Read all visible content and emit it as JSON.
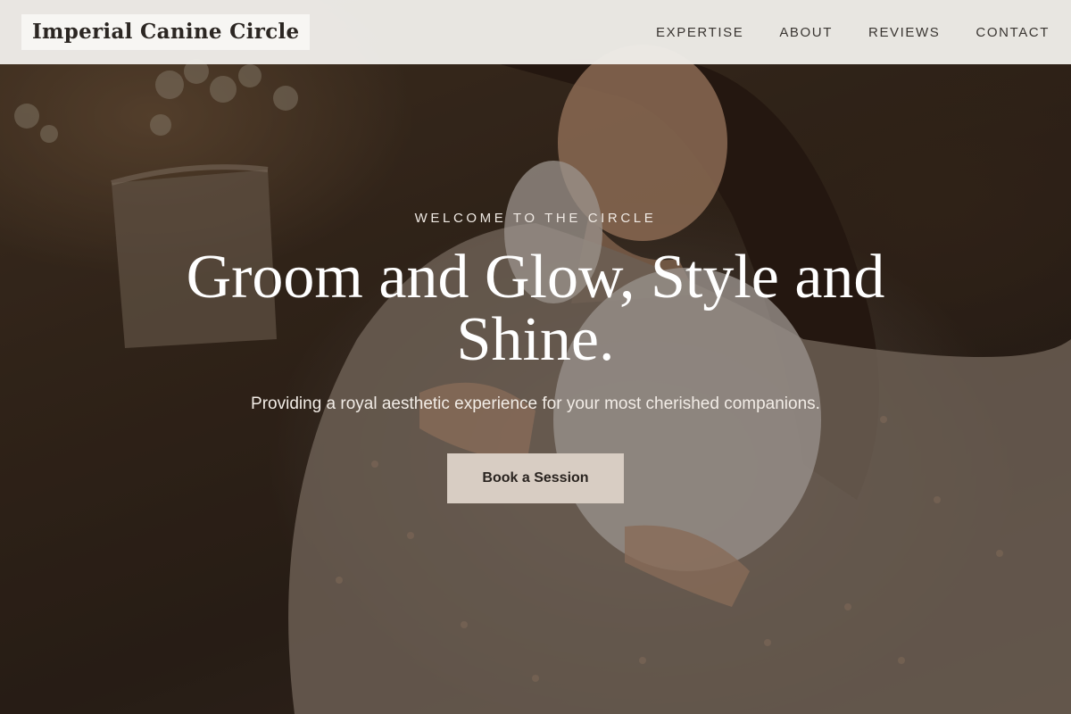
{
  "brand": {
    "name": "Imperial Canine Circle"
  },
  "nav": {
    "items": [
      {
        "label": "EXPERTISE"
      },
      {
        "label": "ABOUT"
      },
      {
        "label": "REVIEWS"
      },
      {
        "label": "CONTACT"
      }
    ]
  },
  "hero": {
    "eyebrow": "WELCOME TO THE CIRCLE",
    "headline": "Groom and Glow, Style and Shine.",
    "subline": "Providing a royal aesthetic experience for your most cherished companions.",
    "cta_label": "Book a Session"
  },
  "colors": {
    "header_bg": "#eeece8",
    "cta_bg": "#d8cdc3",
    "text_dark": "#2b2622"
  }
}
